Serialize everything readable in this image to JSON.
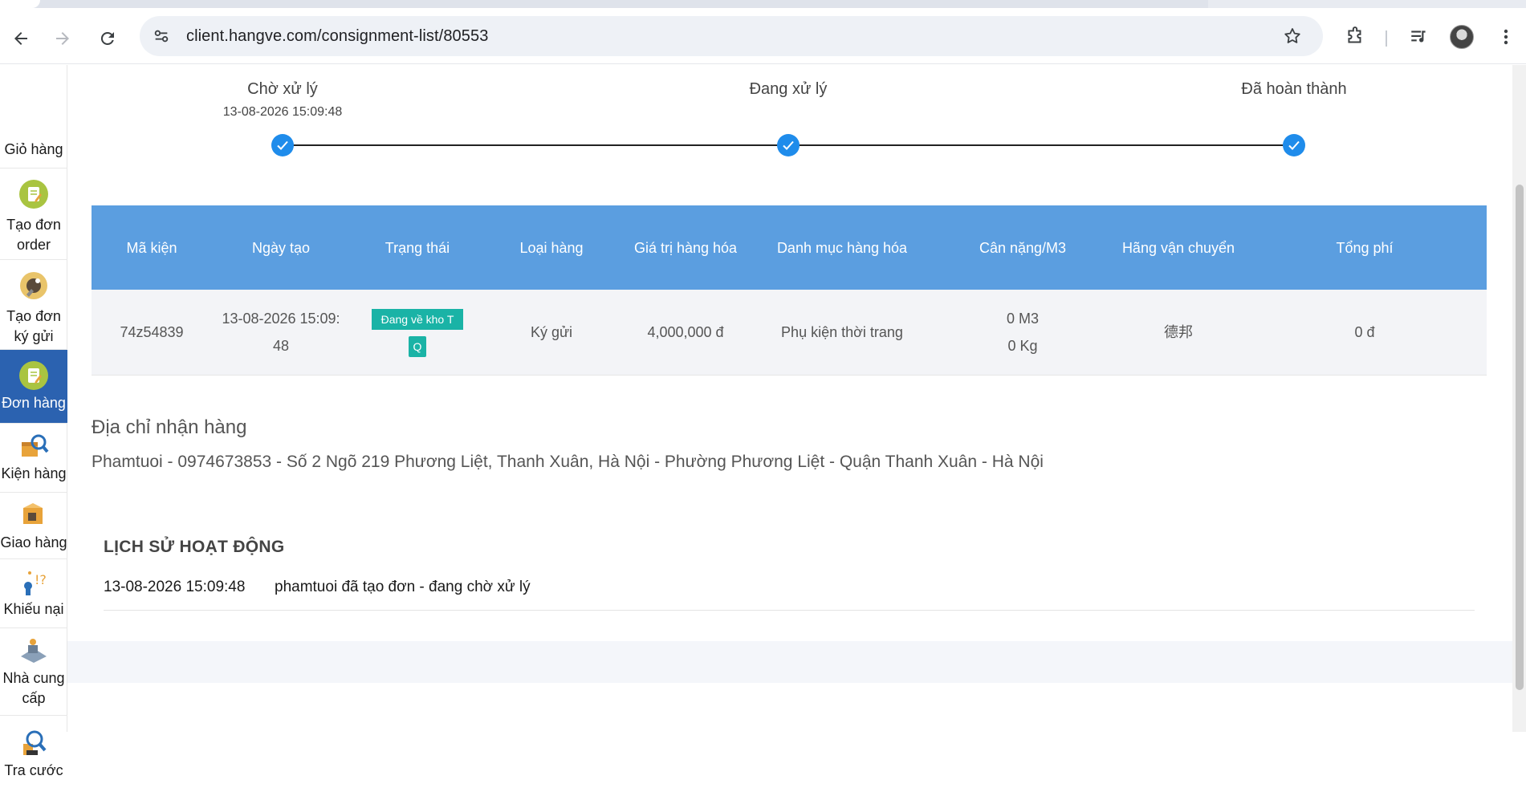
{
  "browser": {
    "url": "client.hangve.com/consignment-list/80553"
  },
  "sidebar": {
    "items": [
      {
        "label": "Giỏ hàng",
        "icon": "cart-icon"
      },
      {
        "label": "Tạo đơn order",
        "icon": "create-order-icon"
      },
      {
        "label": "Tạo đơn ký gửi",
        "icon": "create-consignment-icon"
      },
      {
        "label": "Đơn hàng",
        "icon": "orders-icon",
        "active": true
      },
      {
        "label": "Kiện hàng",
        "icon": "packages-icon"
      },
      {
        "label": "Giao hàng",
        "icon": "delivery-icon"
      },
      {
        "label": "Khiếu nại",
        "icon": "complaint-icon"
      },
      {
        "label": "Nhà cung cấp",
        "icon": "supplier-icon"
      },
      {
        "label": "Tra cước",
        "icon": "fee-lookup-icon"
      }
    ]
  },
  "steps": [
    {
      "title": "Chờ xử lý",
      "time": "13-08-2026 15:09:48"
    },
    {
      "title": "Đang xử lý",
      "time": ""
    },
    {
      "title": "Đã hoàn thành",
      "time": ""
    }
  ],
  "table": {
    "headers": [
      "Mã kiện",
      "Ngày tạo",
      "Trạng thái",
      "Loại hàng",
      "Giá trị hàng hóa",
      "Danh mục hàng hóa",
      "Cân nặng/M3",
      "Hãng vận chuyển",
      "Tổng phí"
    ],
    "rows": [
      {
        "code": "74z54839",
        "created": "13-08-2026 15:09:48",
        "status_part1": "Đang về kho T",
        "status_part2": "Q",
        "type": "Ký gửi",
        "value": "4,000,000 đ",
        "category": "Phụ kiện thời trang",
        "volume": "0 M3",
        "weight": "0 Kg",
        "carrier": "德邦",
        "fee": "0 đ"
      }
    ]
  },
  "address": {
    "title": "Địa chỉ nhận hàng",
    "text": "Phamtuoi - 0974673853 - Số 2 Ngõ 219 Phương Liệt, Thanh Xuân, Hà Nội - Phường Phương Liệt - Quận Thanh Xuân - Hà Nội"
  },
  "history": {
    "title": "LỊCH SỬ HOẠT ĐỘNG",
    "entries": [
      {
        "time": "13-08-2026 15:09:48",
        "text": "phamtuoi đã tạo đơn - đang chờ xử lý"
      }
    ]
  },
  "colors": {
    "accent": "#5b9ee0",
    "step_dot": "#1f8ceb",
    "status_badge": "#1ab3a6",
    "sidebar_active": "#2b62b0"
  }
}
